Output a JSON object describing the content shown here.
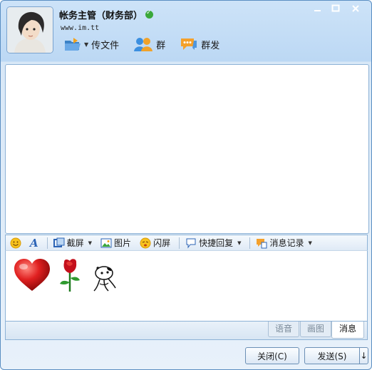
{
  "header": {
    "contact_name": "帐务主管（财务部）",
    "signature": "www.im.tt",
    "toolbar": {
      "send_file_label": "传文件",
      "group_label": "群",
      "group_send_label": "群发"
    }
  },
  "window_controls": [
    "minimize-icon",
    "maximize-icon",
    "close-icon"
  ],
  "composer_toolbar": {
    "screenshot_label": "截屏",
    "image_label": "图片",
    "nudge_label": "闪屏",
    "quick_reply_label": "快捷回复",
    "history_label": "消息记录"
  },
  "input": {
    "stickers": [
      "heart-icon",
      "rose-icon",
      "cartoon-cow-icon"
    ]
  },
  "tabs": [
    {
      "label": "语音",
      "active": false
    },
    {
      "label": "画图",
      "active": false
    },
    {
      "label": "消息",
      "active": true
    }
  ],
  "buttons": {
    "close_label": "关闭(C)",
    "send_label": "发送(S)",
    "send_options_arrow": "↓"
  },
  "colors": {
    "frame": "#5a8ec2",
    "online": "#3aa83a",
    "heart": "#e02020",
    "rose": "#c4101c"
  }
}
